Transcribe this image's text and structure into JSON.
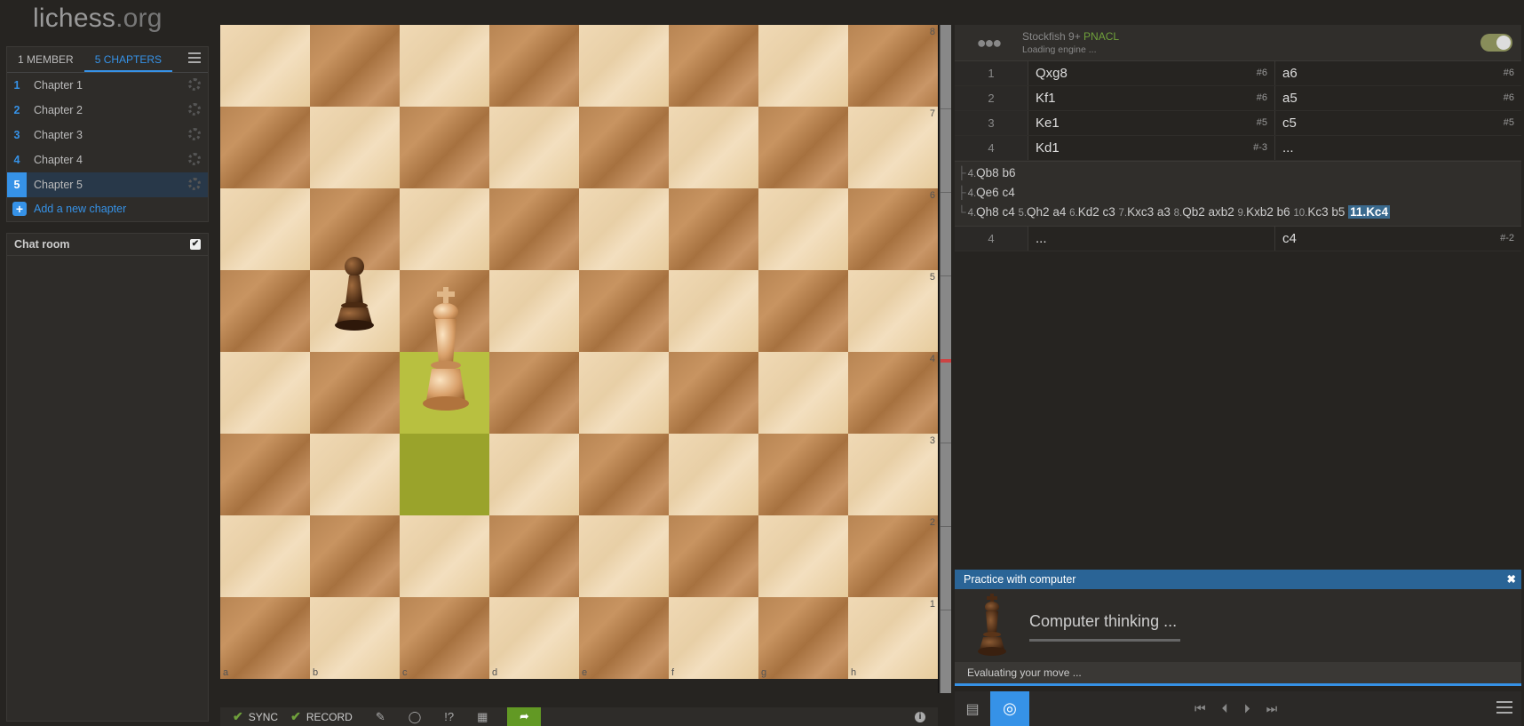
{
  "site": {
    "logo_main": "lichess",
    "logo_suffix": ".org"
  },
  "study": {
    "tabs": [
      "1 MEMBER",
      "5 CHAPTERS"
    ],
    "chapters": [
      {
        "num": "1",
        "name": "Chapter 1"
      },
      {
        "num": "2",
        "name": "Chapter 2"
      },
      {
        "num": "3",
        "name": "Chapter 3"
      },
      {
        "num": "4",
        "name": "Chapter 4"
      },
      {
        "num": "5",
        "name": "Chapter 5"
      }
    ],
    "active_chapter": "5",
    "add_chapter": "Add a new chapter"
  },
  "chat": {
    "title": "Chat room",
    "enabled": true
  },
  "board": {
    "ranks": [
      "8",
      "7",
      "6",
      "5",
      "4",
      "3",
      "2",
      "1"
    ],
    "files": [
      "a",
      "b",
      "c",
      "d",
      "e",
      "f",
      "g",
      "h"
    ],
    "pieces": [
      {
        "square": "b5",
        "type": "pawn",
        "color": "black"
      },
      {
        "square": "c4",
        "type": "king",
        "color": "white"
      }
    ],
    "last_move": [
      "c3",
      "c4"
    ]
  },
  "toolbar": {
    "sync": "SYNC",
    "record": "RECORD"
  },
  "engine": {
    "name": "Stockfish 9+",
    "tag": "PNACL",
    "status": "Loading engine ..."
  },
  "moves": [
    {
      "num": "1",
      "white": "Qxg8",
      "white_eval": "#6",
      "black": "a6",
      "black_eval": "#6"
    },
    {
      "num": "2",
      "white": "Kf1",
      "white_eval": "#6",
      "black": "a5",
      "black_eval": "#6"
    },
    {
      "num": "3",
      "white": "Ke1",
      "white_eval": "#5",
      "black": "c5",
      "black_eval": "#5"
    },
    {
      "num": "4",
      "white": "Kd1",
      "white_eval": "#-3",
      "black": "...",
      "black_eval": ""
    }
  ],
  "variations": {
    "line1": {
      "n1": "4.",
      "m1": "Qb8 b6"
    },
    "line2": {
      "n1": "4.",
      "m1": "Qe6 c4"
    },
    "line3": {
      "n1": "4.",
      "m1": "Qh8 c4 ",
      "n2": "5.",
      "m2": "Qh2 a4 ",
      "n3": "6.",
      "m3": "Kd2 c3 ",
      "n4": "7.",
      "m4": "Kxc3 a3 ",
      "n5": "8.",
      "m5": "Qb2 axb2 ",
      "n6": "9.",
      "m6": "Kxb2 b6 ",
      "n7": "10.",
      "m7": "Kc3 b5 ",
      "n8": "11.",
      "m8": "Kc4"
    }
  },
  "moves_after": {
    "num": "4",
    "white": "...",
    "black": "c4",
    "black_eval": "#-2"
  },
  "practice": {
    "title": "Practice with computer",
    "message": "Computer thinking ...",
    "footer": "Evaluating your move ..."
  },
  "colors": {
    "accent": "#3692e7",
    "practice_header": "#2a6496",
    "share": "#629924",
    "highlight": "#9aa32b"
  }
}
